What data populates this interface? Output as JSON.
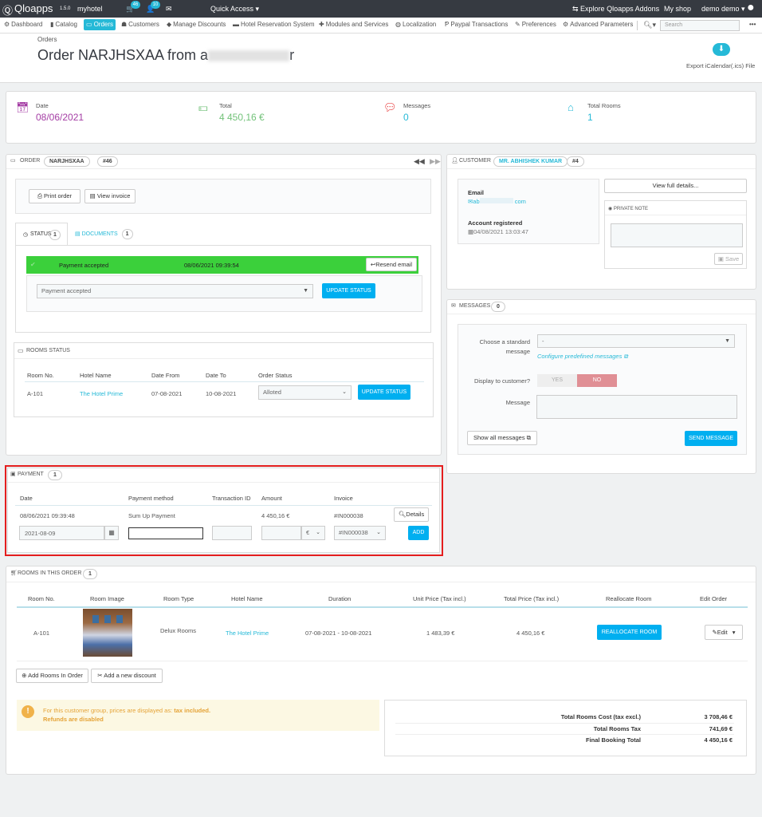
{
  "topbar": {
    "logo": "Qloapps",
    "version": "1.5.0",
    "shop": "myhotel",
    "cart_count": "46",
    "customer_count": "10",
    "quick_access": "Quick Access",
    "explore": "Explore Qloapps Addons",
    "my_shop": "My shop",
    "user": "demo demo"
  },
  "menu": [
    "Dashboard",
    "Catalog",
    "Orders",
    "Customers",
    "Manage Discounts",
    "Hotel Reservation System",
    "Modules and Services",
    "Localization",
    "Paypal Transactions",
    "Preferences",
    "Advanced Parameters"
  ],
  "search": {
    "placeholder": "Search"
  },
  "header": {
    "breadcrumb": "Orders",
    "title_prefix": "Order NARJHSXAA from a",
    "title_suffix": "r",
    "export": "Export iCalendar(.ics) File"
  },
  "kpis": [
    {
      "label": "Date",
      "value": "08/06/2021",
      "color": "#a43da4"
    },
    {
      "label": "Total",
      "value": "4 450,16 €",
      "color": "#72c279"
    },
    {
      "label": "Messages",
      "value": "0",
      "color": "#25b9d7"
    },
    {
      "label": "Total Rooms",
      "value": "1",
      "color": "#25b9d7"
    }
  ],
  "order": {
    "label": "ORDER",
    "ref": "NARJHSXAA",
    "id": "#46",
    "print": "Print order",
    "view_invoice": "View invoice",
    "tab_status": "STATUS",
    "tab_status_count": "1",
    "tab_documents": "DOCUMENTS",
    "tab_documents_count": "1",
    "status_name": "Payment accepted",
    "status_date": "08/06/2021 09:39:54",
    "resend": "Resend email",
    "select_value": "Payment accepted",
    "update": "UPDATE STATUS"
  },
  "rooms_status": {
    "title": "ROOMS STATUS",
    "headers": [
      "Room No.",
      "Hotel Name",
      "Date From",
      "Date To",
      "Order Status"
    ],
    "row": {
      "room": "A-101",
      "hotel": "The Hotel Prime",
      "from": "07-08-2021",
      "to": "10-08-2021",
      "status": "Alloted"
    },
    "update": "UPDATE STATUS"
  },
  "customer": {
    "label": "CUSTOMER",
    "name": "MR. ABHISHEK KUMAR",
    "id": "#4",
    "email_label": "Email",
    "email_start": "ab",
    "email_end": "com",
    "registered_label": "Account registered",
    "registered_value": "04/08/2021 13:03:47",
    "full_details": "View full details...",
    "private_note": "PRIVATE NOTE",
    "save": "Save"
  },
  "messages": {
    "label": "MESSAGES",
    "count": "0",
    "choose_label_1": "Choose a standard",
    "choose_label_2": "message",
    "choose_value": "-",
    "configure": "Configure predefined messages",
    "display_label": "Display to customer?",
    "yes": "YES",
    "no": "NO",
    "message_label": "Message",
    "show_all": "Show all messages",
    "send": "SEND MESSAGE"
  },
  "payment": {
    "label": "PAYMENT",
    "count": "1",
    "headers": [
      "Date",
      "Payment method",
      "Transaction ID",
      "Amount",
      "Invoice"
    ],
    "row": {
      "date": "08/06/2021 09:39:48",
      "method": "Sum Up Payment",
      "amount": "4 450,16 €",
      "invoice": "#IN000038",
      "details": "Details"
    },
    "new_date": "2021-08-09",
    "currency": "€",
    "new_invoice": "#IN000038",
    "add": "ADD"
  },
  "rooms_order": {
    "label": "ROOMS IN THIS ORDER",
    "count": "1",
    "headers": [
      "Room No.",
      "Room Image",
      "Room Type",
      "Hotel Name",
      "Duration",
      "Unit Price (Tax incl.)",
      "Total Price (Tax incl.)",
      "Reallocate Room",
      "Edit Order"
    ],
    "row": {
      "room": "A-101",
      "type": "Delux Rooms",
      "hotel": "The Hotel Prime",
      "duration": "07-08-2021 -  10-08-2021",
      "unit": "1 483,39 €",
      "total": "4 450,16 €",
      "reallocate": "REALLOCATE ROOM",
      "edit": "Edit"
    },
    "add_rooms": "Add Rooms In Order",
    "add_discount": "Add a new discount",
    "notice_text": "For this customer group, prices are displayed as:",
    "notice_bold": "tax included.",
    "refunds": "Refunds are disabled"
  },
  "totals": [
    {
      "label": "Total Rooms Cost (tax excl.)",
      "value": "3 708,46 €"
    },
    {
      "label": "Total Rooms Tax",
      "value": "741,69 €"
    },
    {
      "label": "Final Booking Total",
      "value": "4 450,16 €"
    }
  ],
  "colors": {
    "accent": "#25b9d7",
    "button": "#00aff0",
    "success": "#3bd03b",
    "highlight": "#e41e1e",
    "warning_bg": "#fcf8e3"
  }
}
